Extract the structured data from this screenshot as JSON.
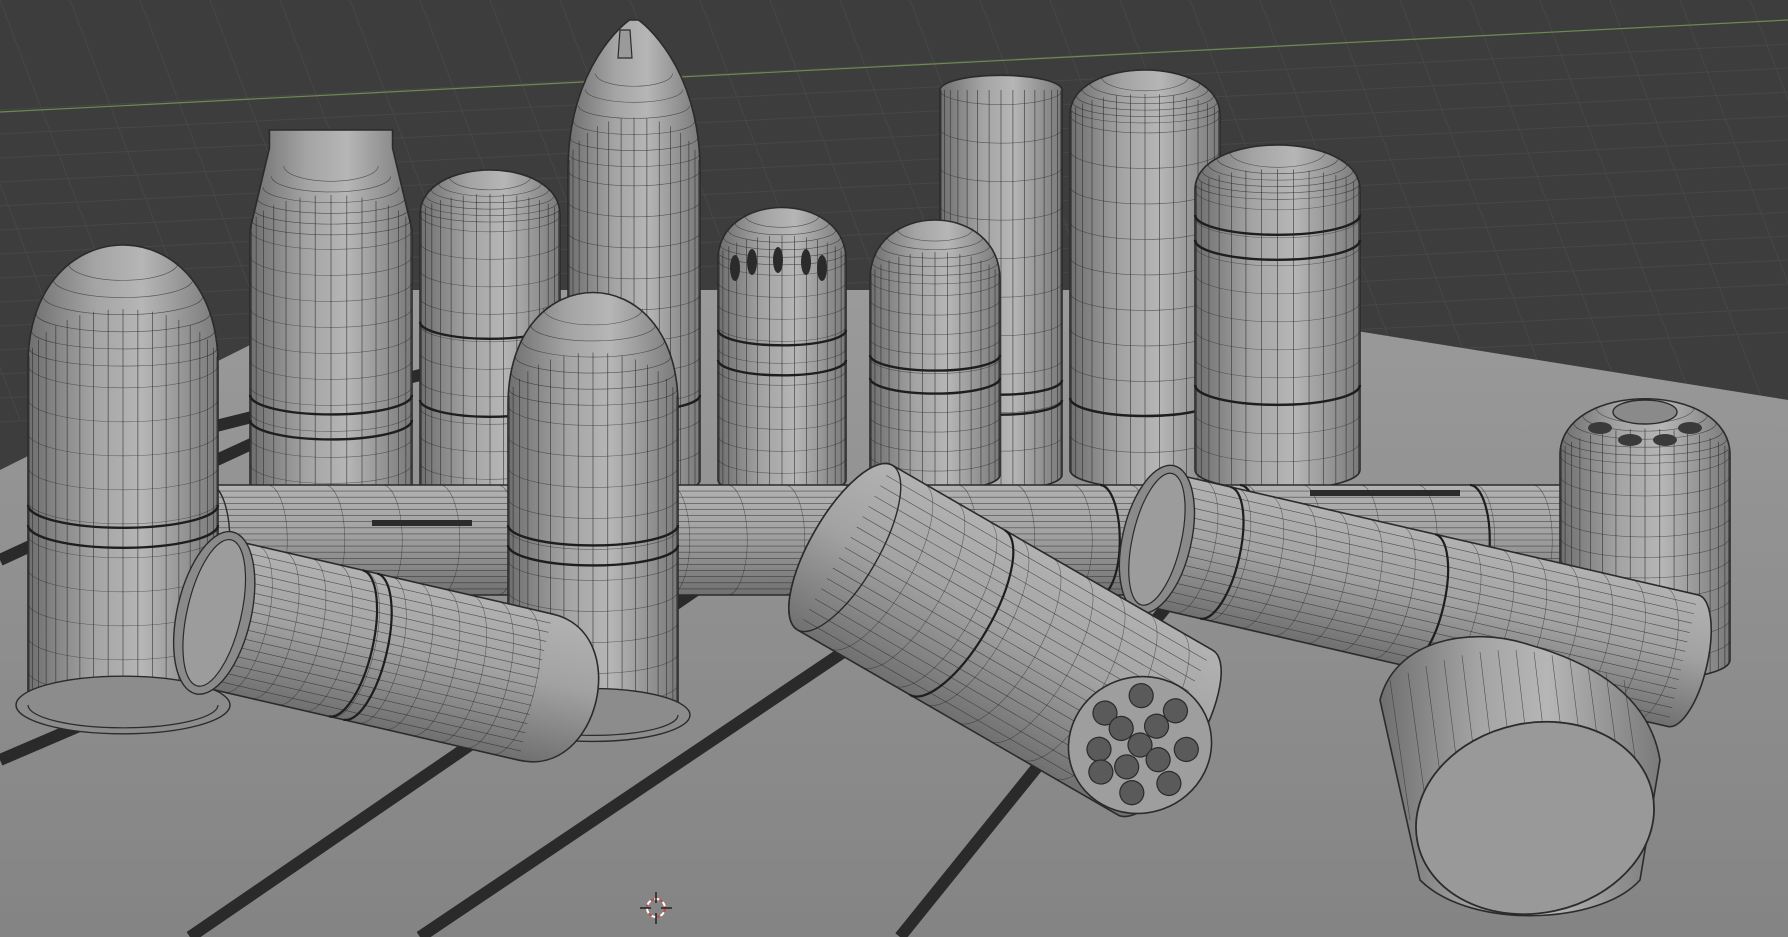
{
  "viewport": {
    "mode": "solid-wireframe",
    "background_color": "#3d3d3d",
    "floor_color": "#8e8e8e",
    "floor_stripe_color": "#2a2a2a",
    "object_fill_color": "#9a9a9a",
    "object_shadow_color": "#6e6e6e",
    "object_highlight_color": "#bcbcbc",
    "wire_color": "#2b2b2b",
    "horizon_axis_color": "#6e8a52"
  },
  "scene": {
    "object_types": [
      "grenade-round-upright",
      "bottleneck-round",
      "rounded-cylinder-round",
      "ogive-tip-round",
      "vented-dome-round",
      "pointed-dome-round",
      "tall-pipe-round",
      "rounded-tall-round",
      "banded-dome-round",
      "long-tube-lying",
      "grenade-lying",
      "multi-flechette-lying",
      "banded-lying-round",
      "cluster-upright-round",
      "flat-canister-lying"
    ]
  },
  "cursor": {
    "icon": "3d-cursor-icon"
  }
}
